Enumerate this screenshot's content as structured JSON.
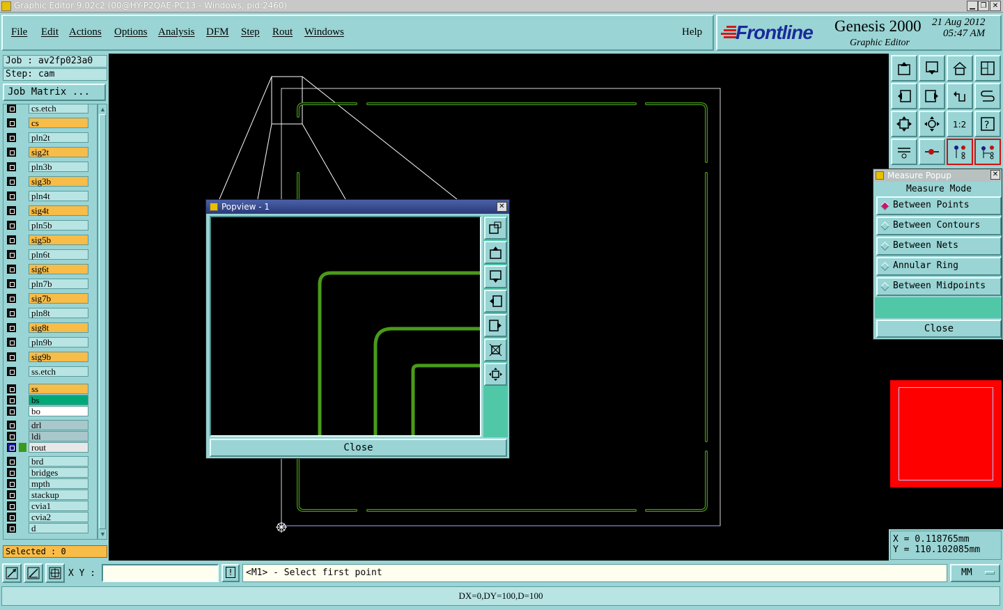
{
  "window": {
    "title": "Graphic Editor 9.02c2 (00@HY-P2QAE-PC13 - Windows, pid:2460)"
  },
  "menu": {
    "items": [
      "File",
      "Edit",
      "Actions",
      "Options",
      "Analysis",
      "DFM",
      "Step",
      "Rout",
      "Windows"
    ],
    "help": "Help"
  },
  "brand": {
    "logo": "Frontline",
    "product": "Genesis 2000",
    "subtitle": "Graphic Editor",
    "date": "21 Aug 2012",
    "time": "05:47 AM",
    "logo_color": "#1a2a9a",
    "accent_color": "#d81818"
  },
  "job": {
    "job_label": "Job : av2fp023a0",
    "step_label": "Step: cam",
    "matrix_button": "Job Matrix ..."
  },
  "layers": [
    {
      "name": "cs.etch",
      "type": "board"
    },
    {
      "name": "cs",
      "type": "signal"
    },
    {
      "name": "pln2t",
      "type": "board"
    },
    {
      "name": "sig2t",
      "type": "signal"
    },
    {
      "name": "pln3b",
      "type": "board"
    },
    {
      "name": "sig3b",
      "type": "signal"
    },
    {
      "name": "pln4t",
      "type": "board"
    },
    {
      "name": "sig4t",
      "type": "signal"
    },
    {
      "name": "pln5b",
      "type": "board"
    },
    {
      "name": "sig5b",
      "type": "signal"
    },
    {
      "name": "pln6t",
      "type": "board"
    },
    {
      "name": "sig6t",
      "type": "signal"
    },
    {
      "name": "pln7b",
      "type": "board"
    },
    {
      "name": "sig7b",
      "type": "signal"
    },
    {
      "name": "pln8t",
      "type": "board"
    },
    {
      "name": "sig8t",
      "type": "signal"
    },
    {
      "name": "pln9b",
      "type": "board"
    },
    {
      "name": "sig9b",
      "type": "signal"
    },
    {
      "name": "ss.etch",
      "type": "board"
    },
    {
      "name": "ss",
      "type": "signal"
    },
    {
      "name": "bs",
      "type": "bs"
    },
    {
      "name": "bo",
      "type": "bo"
    },
    {
      "name": "drl",
      "type": "drill"
    },
    {
      "name": "ldi",
      "type": "drill"
    },
    {
      "name": "rout",
      "type": "rout",
      "active": true
    },
    {
      "name": "brd",
      "type": "board"
    },
    {
      "name": "bridges",
      "type": "board"
    },
    {
      "name": "mpth",
      "type": "board"
    },
    {
      "name": "stackup",
      "type": "board"
    },
    {
      "name": "cvia1",
      "type": "board"
    },
    {
      "name": "cvia2",
      "type": "board"
    },
    {
      "name": "d",
      "type": "board"
    }
  ],
  "selected_label": "Selected : 0",
  "popview": {
    "title": "Popview - 1",
    "close_label": "Close"
  },
  "measure": {
    "title": "Measure Popup",
    "heading": "Measure Mode",
    "options": [
      "Between Points",
      "Between Contours",
      "Between Nets",
      "Annular Ring",
      "Between Midpoints"
    ],
    "selected_index": 0,
    "close_label": "Close"
  },
  "coords": {
    "x_label": "X = 0.118765mm",
    "y_label": "Y = 110.102085mm"
  },
  "bottom": {
    "xy_label": "X Y :",
    "xy_value": "",
    "excl_label": "!",
    "prompt": "<M1> - Select first point",
    "units": "MM",
    "status": "DX=0,DY=100,D=100"
  },
  "colors": {
    "rout": "#4a9a1a",
    "signal": "#f8bc48",
    "panel": "#9ad4d4",
    "minimap": "#ff0000"
  }
}
